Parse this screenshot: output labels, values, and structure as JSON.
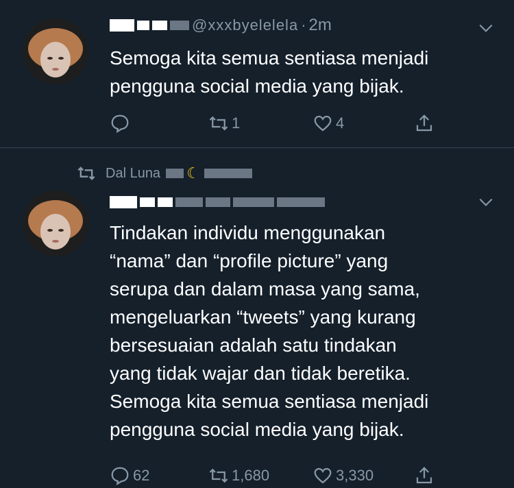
{
  "tweets": [
    {
      "header": {
        "handle": "@xxxbyelelela",
        "separator": "·",
        "time": "2m"
      },
      "text": "Semoga kita semua sentiasa menjadi\npengguna social media yang bijak.",
      "actions": {
        "reply": "",
        "retweet": "1",
        "like": "4"
      }
    },
    {
      "retweet_label": "Dal Luna",
      "text": "Tindakan individu menggunakan\n“nama” dan “profile picture” yang\nserupa dan dalam masa yang sama,\nmengeluarkan “tweets” yang kurang\nbersesuaian adalah satu tindakan\nyang tidak wajar dan tidak beretika.\nSemoga kita semua sentiasa menjadi\npengguna social media yang bijak.",
      "actions": {
        "reply": "62",
        "retweet": "1,680",
        "like": "3,330"
      }
    }
  ],
  "icons": [
    "chevron-down-icon",
    "reply-icon",
    "retweet-icon",
    "like-icon",
    "share-icon"
  ],
  "colors": {
    "background": "#15202b",
    "muted": "#8899a6",
    "divider": "#38444d"
  }
}
